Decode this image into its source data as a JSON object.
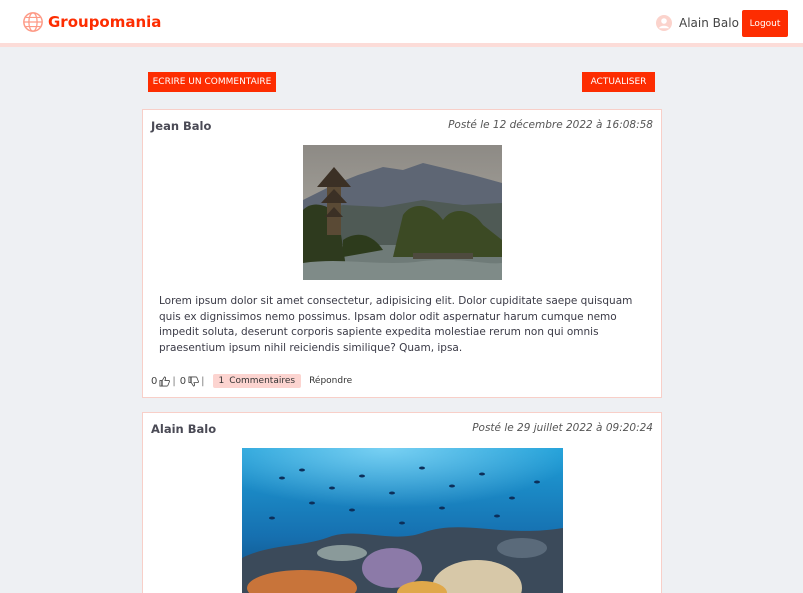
{
  "header": {
    "brand": "Groupomania",
    "user_name": "Alain Balo",
    "logout_label": "Logout",
    "brand_color": "#fd2d01"
  },
  "toolbar": {
    "write_label": "ECRIRE UN COMMENTAIRE",
    "refresh_label": "ACTUALISER"
  },
  "posts": [
    {
      "author": "Jean Balo",
      "date": "Posté le 12 décembre 2022 à 16:08:58",
      "image": "pagoda-landscape",
      "text": "Lorem ipsum dolor sit amet consectetur, adipisicing elit. Dolor cupiditate saepe quisquam quis ex dignissimos nemo possimus. Ipsam dolor odit aspernatur harum cumque nemo impedit soluta, deserunt corporis sapiente expedita molestiae rerum non qui omnis praesentium ipsum nihil reiciendis similique? Quam, ipsa.",
      "likes": "0",
      "dislikes": "0",
      "comments_count": "1",
      "comments_label": "Commentaires",
      "reply_label": "Répondre"
    },
    {
      "author": "Alain Balo",
      "date": "Posté le 29 juillet 2022 à 09:20:24",
      "image": "coral-reef"
    }
  ]
}
